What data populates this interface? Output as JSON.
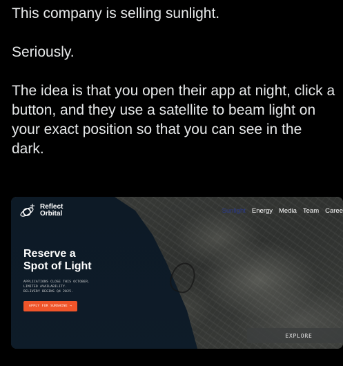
{
  "post": {
    "line1": "This company is selling sunlight.",
    "line2": "Seriously.",
    "line3": "The idea is that you open their app at night, click a button, and they use a satellite to beam light on your exact position so that you can see in the dark."
  },
  "card": {
    "logo": {
      "line1": "Reflect",
      "line2": "Orbital",
      "icon": "orbit-logo-icon"
    },
    "nav": [
      "Energy",
      "Media",
      "Team",
      "Caree"
    ],
    "nav_hidden": "Sunlight",
    "hero": {
      "title_line1": "Reserve a",
      "title_line2": "Spot of Light",
      "sub_line1": "APPLICATIONS CLOSE THIS OCTOBER.",
      "sub_line2": "LIMITED AVAILABILITY.",
      "sub_line3": "DELIVERY BEGINS Q4 2025.",
      "apply_label": "APPLY FOR SUNSHINE →"
    },
    "explore_label": "EXPLORE",
    "colors": {
      "accent": "#f0552a",
      "ocean": "#0d1a26",
      "background": "#000000"
    }
  }
}
